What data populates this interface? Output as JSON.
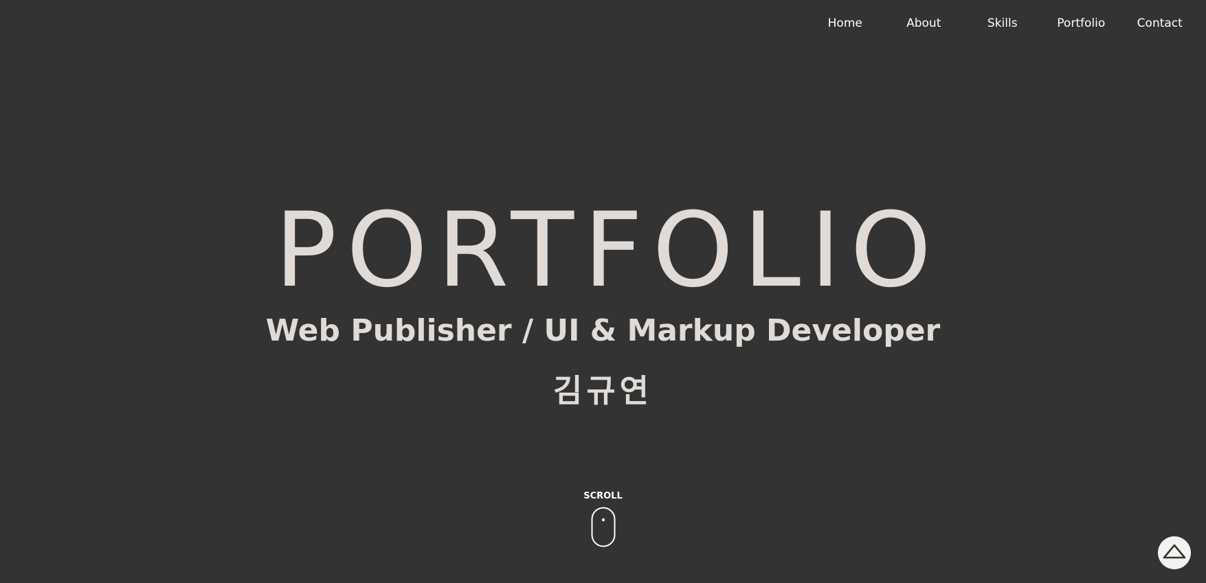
{
  "nav": {
    "items": [
      {
        "label": "Home"
      },
      {
        "label": "About"
      },
      {
        "label": "Skills"
      },
      {
        "label": "Portfolio"
      },
      {
        "label": "Contact"
      }
    ]
  },
  "hero": {
    "title": "PORTFOLIO",
    "subtitle": "Web Publisher / UI & Markup Developer",
    "name": "김규연"
  },
  "scroll": {
    "label": "SCROLL",
    "icon": "mouse-icon"
  },
  "top_button": {
    "icon": "triangle-up-icon"
  },
  "colors": {
    "background": "#333333",
    "hero_text": "#e0dbd6",
    "nav_text": "#ffffff",
    "top_button_bg": "#f4f2ef"
  }
}
